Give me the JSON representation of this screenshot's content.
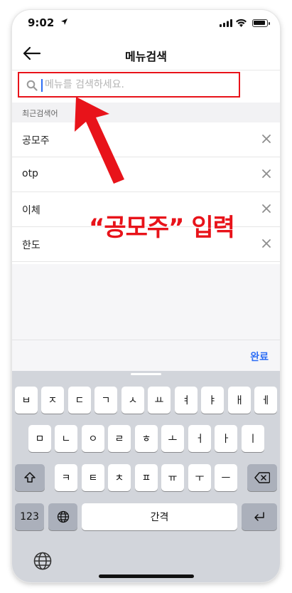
{
  "status_bar": {
    "time": "9:02"
  },
  "header": {
    "title": "메뉴검색"
  },
  "search": {
    "placeholder": "메뉴를 검색하세요.",
    "value": ""
  },
  "recent": {
    "section_title": "최근검색어",
    "items": [
      {
        "label": "공모주"
      },
      {
        "label": "otp"
      },
      {
        "label": "이체"
      },
      {
        "label": "한도"
      }
    ]
  },
  "done_button": "완료",
  "annotation": {
    "text": "“공모주” 입력",
    "color": "#e8131a"
  },
  "keyboard": {
    "row1": [
      "ㅂ",
      "ㅈ",
      "ㄷ",
      "ㄱ",
      "ㅅ",
      "ㅛ",
      "ㅕ",
      "ㅑ",
      "ㅐ",
      "ㅔ"
    ],
    "row2": [
      "ㅁ",
      "ㄴ",
      "ㅇ",
      "ㄹ",
      "ㅎ",
      "ㅗ",
      "ㅓ",
      "ㅏ",
      "ㅣ"
    ],
    "row3": [
      "ㅋ",
      "ㅌ",
      "ㅊ",
      "ㅍ",
      "ㅠ",
      "ㅜ",
      "ㅡ"
    ],
    "numbers_key": "123",
    "space_key": "간격"
  },
  "colors": {
    "accent": "#2d6ef5",
    "highlight": "#e8131a",
    "keyboard_bg": "#d2d5db"
  }
}
